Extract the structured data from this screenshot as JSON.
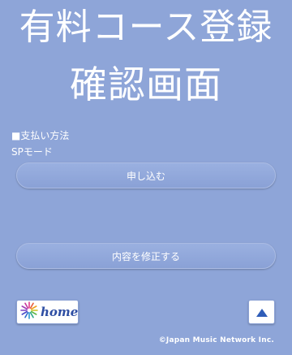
{
  "header": {
    "title_line1": "有料コース登録",
    "title_line2": "確認画面"
  },
  "payment": {
    "heading": "■支払い方法",
    "method": "SPモード"
  },
  "buttons": {
    "apply_label": "申し込む",
    "edit_label": "内容を修正する"
  },
  "footer": {
    "home_label": "home",
    "home_icon": "starburst-logo-icon",
    "top_icon": "triangle-up-icon",
    "copyright": "©Japan Music Network Inc."
  },
  "colors": {
    "background": "#8ea5d8",
    "home_text": "#2e4ea3",
    "arrow": "#2f5db8"
  }
}
